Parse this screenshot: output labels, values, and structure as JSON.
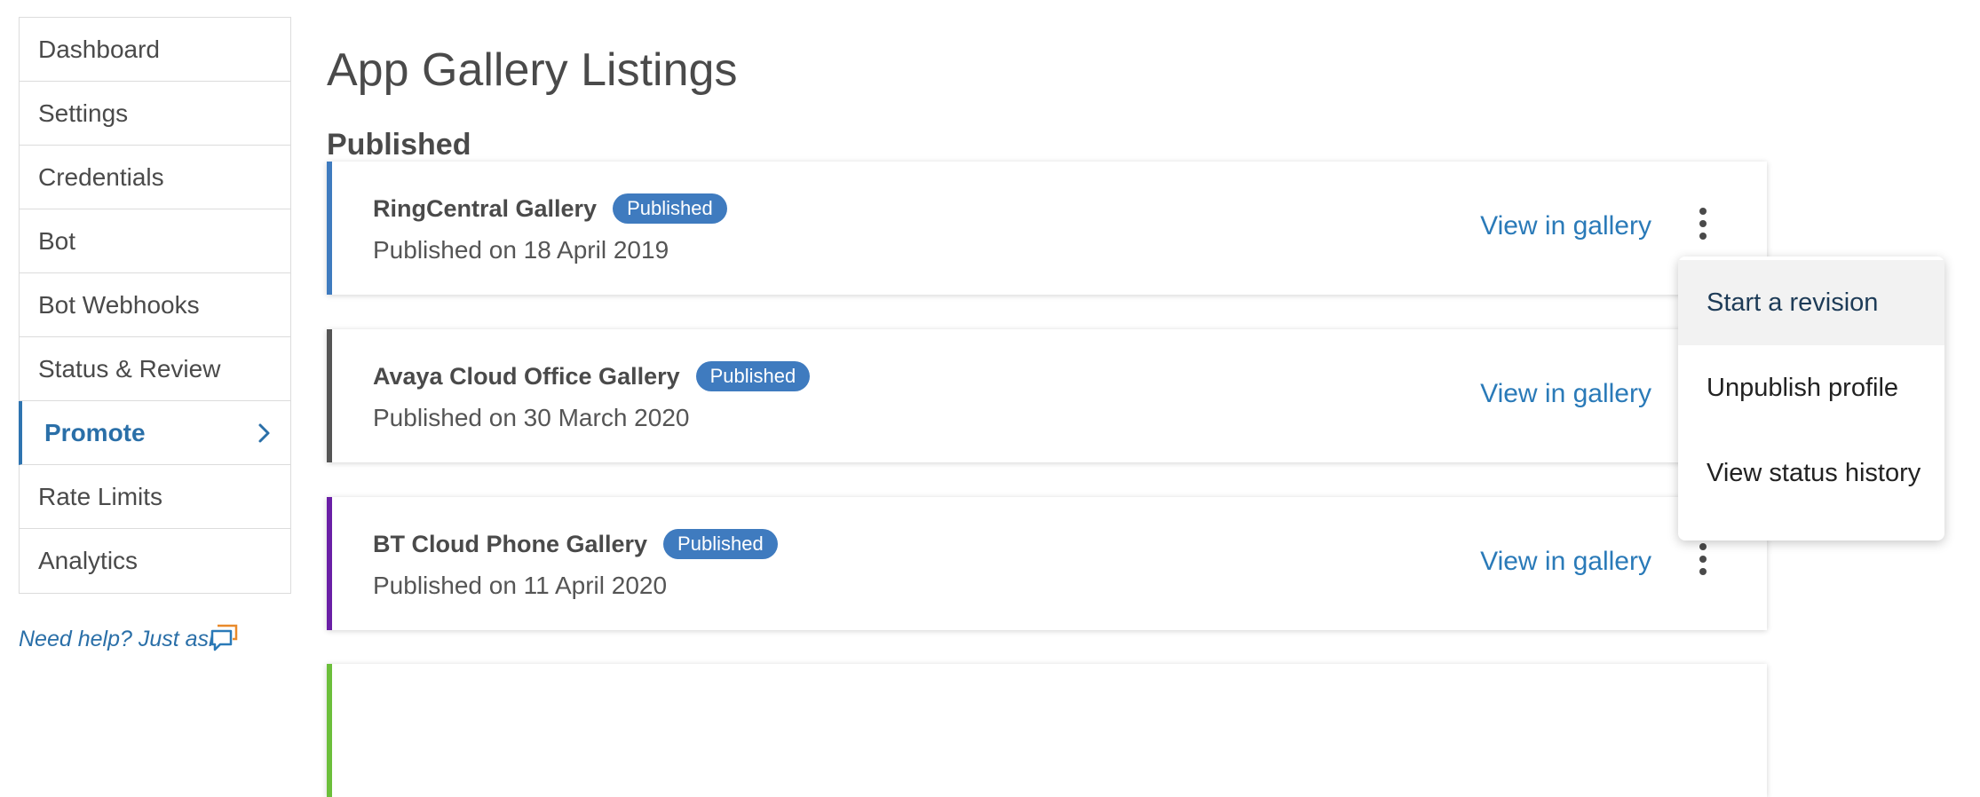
{
  "sidebar": {
    "items": [
      {
        "label": "Dashboard"
      },
      {
        "label": "Settings"
      },
      {
        "label": "Credentials"
      },
      {
        "label": "Bot"
      },
      {
        "label": "Bot Webhooks"
      },
      {
        "label": "Status & Review"
      },
      {
        "label": "Promote",
        "active": true
      },
      {
        "label": "Rate Limits"
      },
      {
        "label": "Analytics"
      }
    ],
    "help_text": "Need help? Just ask"
  },
  "page": {
    "title": "App Gallery Listings",
    "section": "Published"
  },
  "listings": [
    {
      "name": "RingCentral Gallery",
      "badge": "Published",
      "date": "Published on 18 April 2019",
      "link": "View in gallery",
      "accent": "#3f7bbf"
    },
    {
      "name": "Avaya Cloud Office Gallery",
      "badge": "Published",
      "date": "Published on 30 March 2020",
      "link": "View in gallery",
      "accent": "#555555"
    },
    {
      "name": "BT Cloud Phone Gallery",
      "badge": "Published",
      "date": "Published on 11 April 2020",
      "link": "View in gallery",
      "accent": "#6a1fa6"
    },
    {
      "accent": "#6cbf3b"
    }
  ],
  "menu": {
    "items": [
      {
        "label": "Start a revision"
      },
      {
        "label": "Unpublish profile"
      },
      {
        "label": "View status history"
      }
    ]
  },
  "colors": {
    "link": "#2a7ab8",
    "badge": "#3f7bbf",
    "active_nav": "#2a6fa8"
  }
}
